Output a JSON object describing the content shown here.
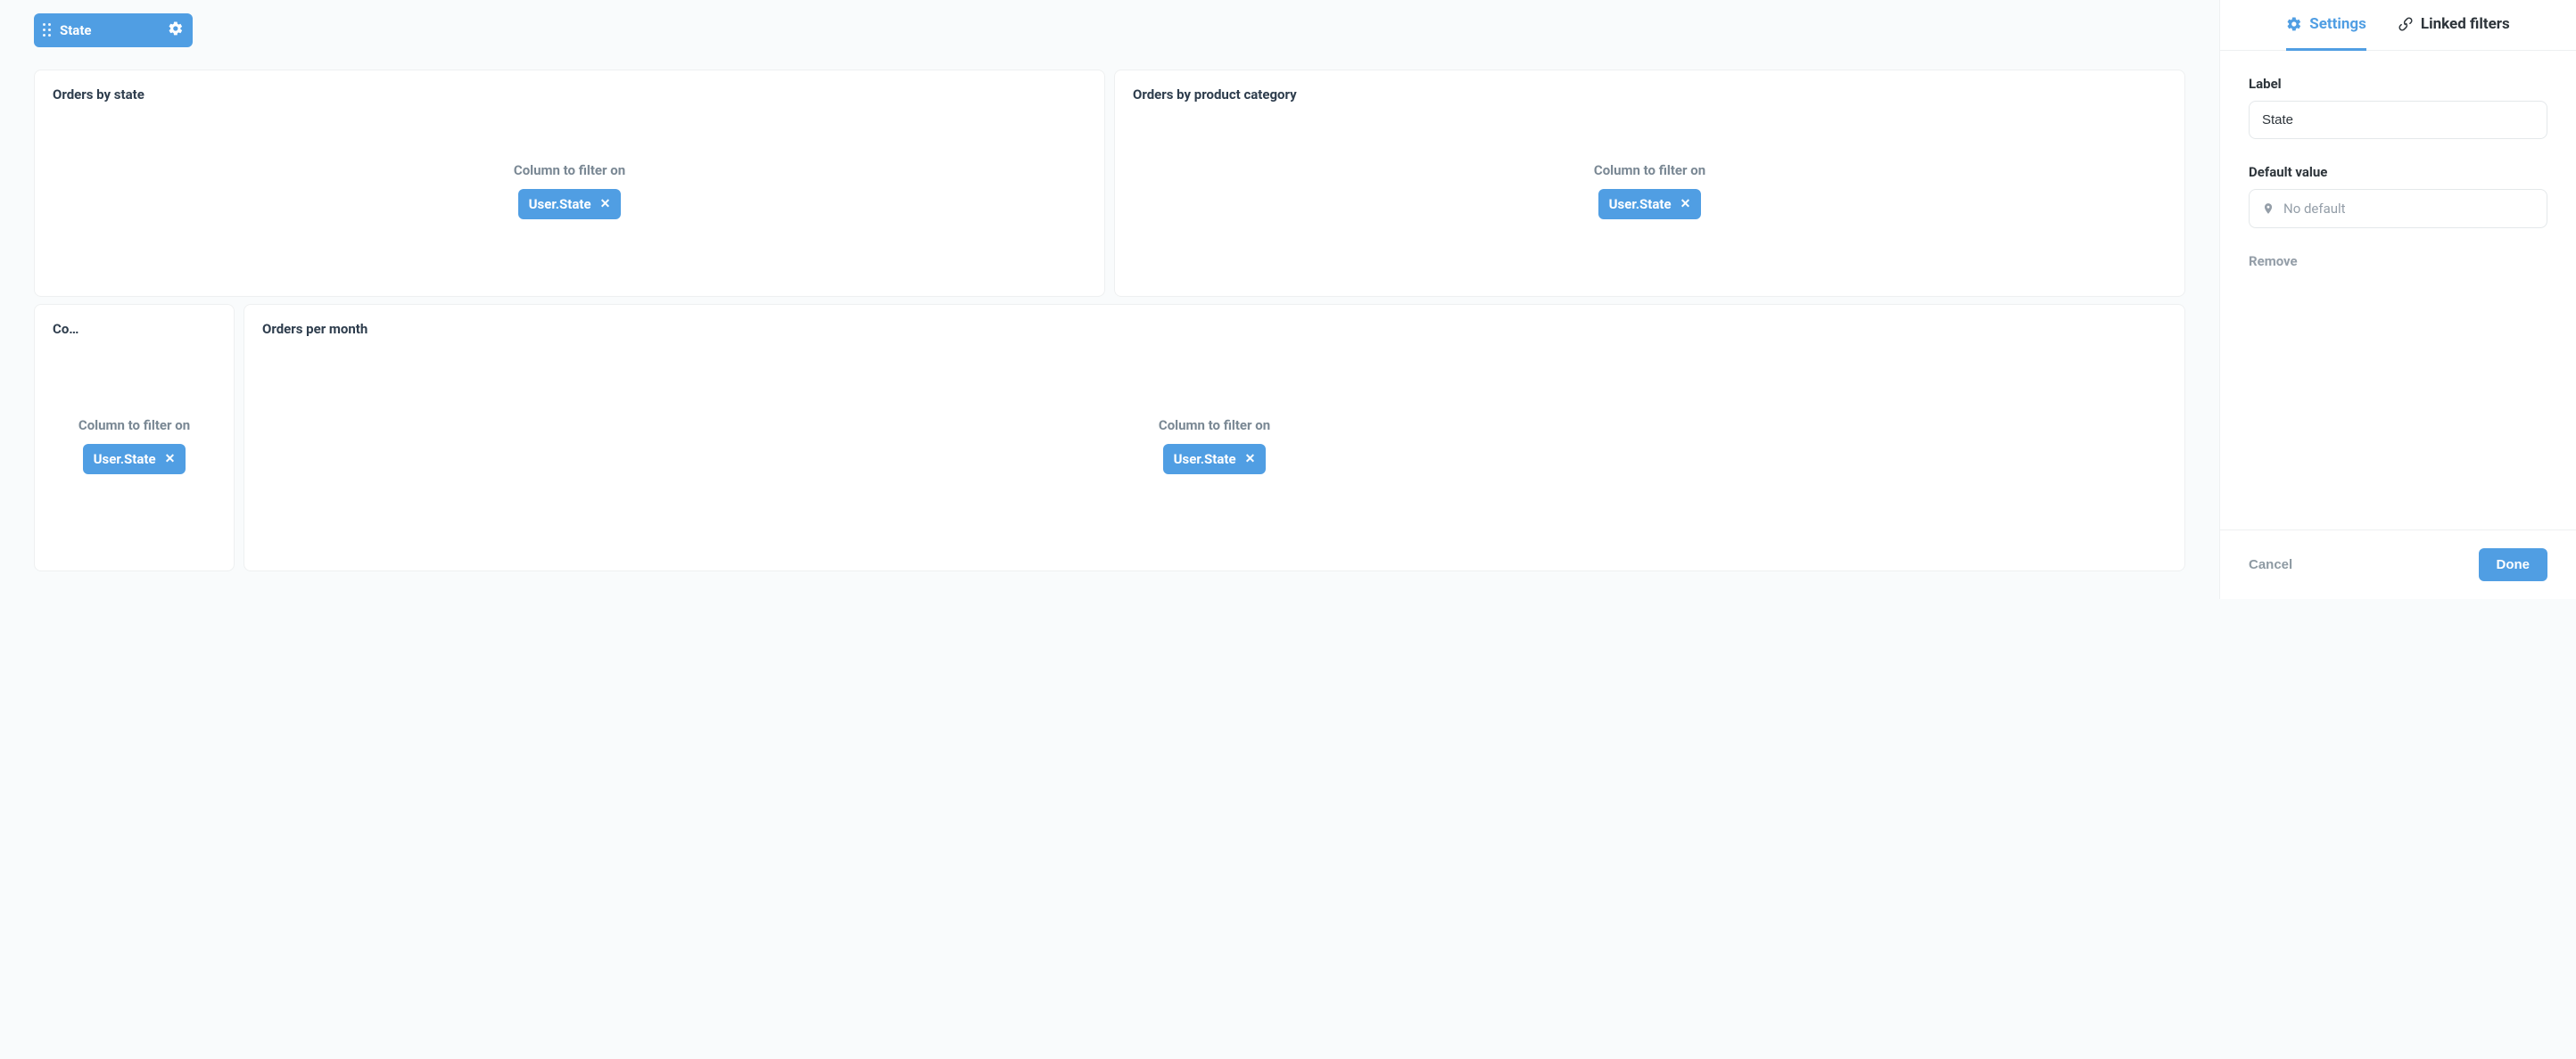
{
  "filter_pill": {
    "label": "State"
  },
  "cards": [
    {
      "title": "Orders by state",
      "filter_label": "Column to filter on",
      "chip": "User.State"
    },
    {
      "title": "Orders by product category",
      "filter_label": "Column to filter on",
      "chip": "User.State"
    },
    {
      "title": "Co…",
      "filter_label": "Column to filter on",
      "chip": "User.State"
    },
    {
      "title": "Orders per month",
      "filter_label": "Column to filter on",
      "chip": "User.State"
    }
  ],
  "sidebar": {
    "tabs": {
      "settings": "Settings",
      "linked_filters": "Linked filters"
    },
    "label": {
      "caption": "Label",
      "value": "State"
    },
    "default_value": {
      "caption": "Default value",
      "placeholder": "No default"
    },
    "remove": "Remove",
    "cancel": "Cancel",
    "done": "Done"
  }
}
